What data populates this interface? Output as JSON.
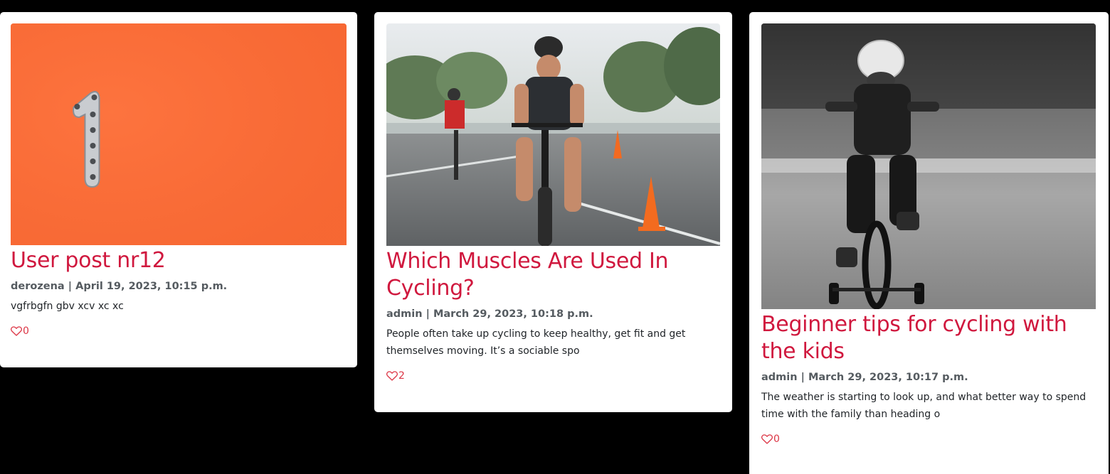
{
  "posts": [
    {
      "title": "User post nr12",
      "meta": "derozena | April 19, 2023, 10:15 p.m.",
      "excerpt": "vgfrbgfn gbv xcv xc xc",
      "likes": "0",
      "image": "chain-link-number-one-on-orange"
    },
    {
      "title": "Which Muscles Are Used In Cycling?",
      "meta": "admin | March 29, 2023, 10:18 p.m.",
      "excerpt": "People often take up cycling to keep healthy, get fit and get themselves moving. It’s a sociable spo",
      "likes": "2",
      "image": "triathlete-cycling-race-with-cones"
    },
    {
      "title": "Beginner tips for cycling with the kids",
      "meta": "admin | March 29, 2023, 10:17 p.m.",
      "excerpt": "The weather is starting to look up, and what better way to spend time with the family than heading o",
      "likes": "0",
      "image": "child-on-bike-with-training-wheels-bw"
    }
  ],
  "colors": {
    "title": "#d0183e",
    "heart": "#dc3545",
    "background": "#000000",
    "card": "#ffffff"
  },
  "icons": {
    "like": "heart-outline-icon"
  }
}
